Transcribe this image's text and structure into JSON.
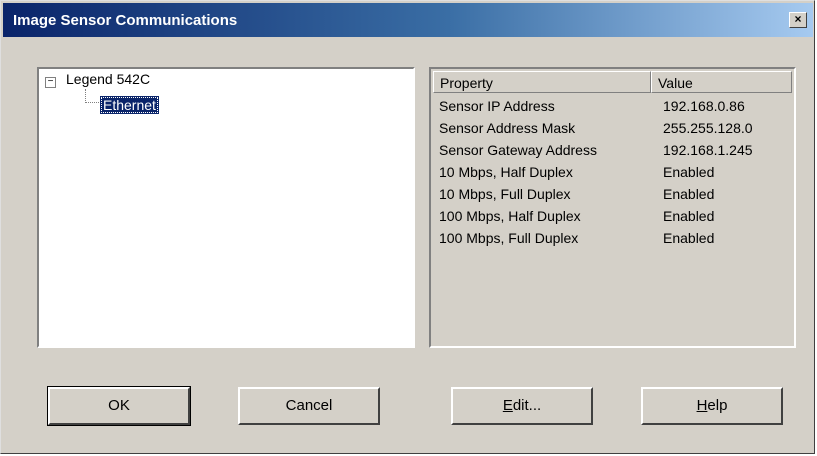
{
  "window": {
    "title": "Image Sensor Communications",
    "close_glyph": "×"
  },
  "tree": {
    "root": {
      "expander": "−",
      "label": "Legend 542C"
    },
    "child": {
      "label": "Ethernet"
    }
  },
  "properties": {
    "headers": {
      "property": "Property",
      "value": "Value"
    },
    "rows": [
      {
        "property": "Sensor IP Address",
        "value": "192.168.0.86"
      },
      {
        "property": "Sensor Address Mask",
        "value": "255.255.128.0"
      },
      {
        "property": "Sensor Gateway Address",
        "value": "192.168.1.245"
      },
      {
        "property": "10 Mbps, Half Duplex",
        "value": "Enabled"
      },
      {
        "property": "10 Mbps, Full Duplex",
        "value": "Enabled"
      },
      {
        "property": "100 Mbps, Half Duplex",
        "value": "Enabled"
      },
      {
        "property": "100 Mbps, Full Duplex",
        "value": "Enabled"
      }
    ]
  },
  "buttons": {
    "ok": "OK",
    "cancel": "Cancel",
    "edit_first": "E",
    "edit_rest": "dit...",
    "help_first": "H",
    "help_rest": "elp"
  }
}
